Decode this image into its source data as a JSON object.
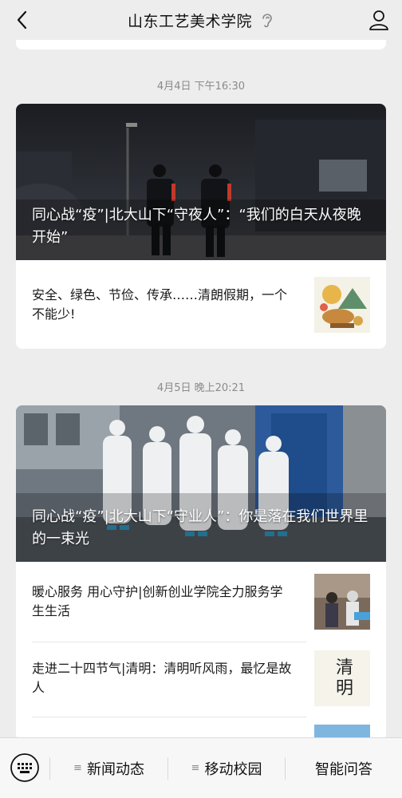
{
  "header": {
    "title": "山东工艺美术学院"
  },
  "messages": [
    {
      "timestamp": "4月4日 下午16:30",
      "hero_title": "同心战“疫”|北大山下“守夜人”：“我们的白天从夜晚开始”",
      "items": [
        {
          "text": "安全、绿色、节俭、传承……清朗假期，一个不能少!"
        }
      ]
    },
    {
      "timestamp": "4月5日 晚上20:21",
      "hero_title": "同心战“疫”|北大山下“守业人”：你是落在我们世界里的一束光",
      "items": [
        {
          "text": "暖心服务 用心守护|创新创业学院全力服务学生生活"
        },
        {
          "text": "走进二十四节气|清明：清明听风雨，最忆是故人",
          "thumb_text": "清明"
        }
      ]
    }
  ],
  "bottom_bar": {
    "tabs": [
      {
        "label": "新闻动态",
        "has_menu_icon": true
      },
      {
        "label": "移动校园",
        "has_menu_icon": true
      },
      {
        "label": "智能问答",
        "has_menu_icon": false
      }
    ],
    "menu_icon_glyph": "≡"
  },
  "colors": {
    "background": "#ededed",
    "card": "#ffffff",
    "timestamp": "#8a8a8a"
  }
}
